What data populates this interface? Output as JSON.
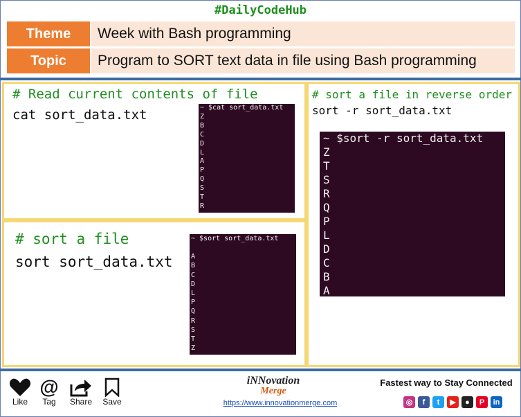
{
  "hashtag": "#DailyCodeHub",
  "header": {
    "theme_label": "Theme",
    "theme_value": "Week with Bash programming",
    "topic_label": "Topic",
    "topic_value": "Program to SORT text data in file using Bash programming"
  },
  "panels": {
    "read": {
      "comment": "# Read current contents of file",
      "command": "cat sort_data.txt",
      "terminal_prompt": "~ $cat sort_data.txt",
      "terminal_lines": [
        "Z",
        "B",
        "C",
        "D",
        "L",
        "A",
        "P",
        "Q",
        "S",
        "T",
        "R"
      ]
    },
    "sort": {
      "comment": "# sort a file",
      "command": "sort sort_data.txt",
      "terminal_prompt": "~ $sort sort_data.txt",
      "terminal_lines": [
        "A",
        "B",
        "C",
        "D",
        "L",
        "P",
        "Q",
        "R",
        "S",
        "T",
        "Z"
      ]
    },
    "reverse": {
      "comment": "# sort a file in reverse order",
      "command": "sort -r sort_data.txt",
      "terminal_prompt": "~ $sort -r sort_data.txt",
      "terminal_lines": [
        "Z",
        "T",
        "S",
        "R",
        "Q",
        "P",
        "L",
        "D",
        "C",
        "B",
        "A"
      ]
    }
  },
  "footer": {
    "actions": {
      "like": "Like",
      "tag": "Tag",
      "share": "Share",
      "save": "Save"
    },
    "brand_line1": "iNNovation",
    "brand_line2": "Merge",
    "url": "https://www.innovationmerge.com",
    "tagline": "Fastest way to Stay Connected",
    "social": [
      {
        "name": "instagram-icon",
        "glyph": "◎",
        "color": "#c13584"
      },
      {
        "name": "facebook-icon",
        "glyph": "f",
        "color": "#3b5998"
      },
      {
        "name": "twitter-icon",
        "glyph": "t",
        "color": "#1da1f2"
      },
      {
        "name": "youtube-icon",
        "glyph": "▶",
        "color": "#e62117"
      },
      {
        "name": "github-icon",
        "glyph": "●",
        "color": "#222222"
      },
      {
        "name": "pinterest-icon",
        "glyph": "P",
        "color": "#e60023"
      },
      {
        "name": "linkedin-icon",
        "glyph": "in",
        "color": "#0a66c2"
      }
    ]
  }
}
